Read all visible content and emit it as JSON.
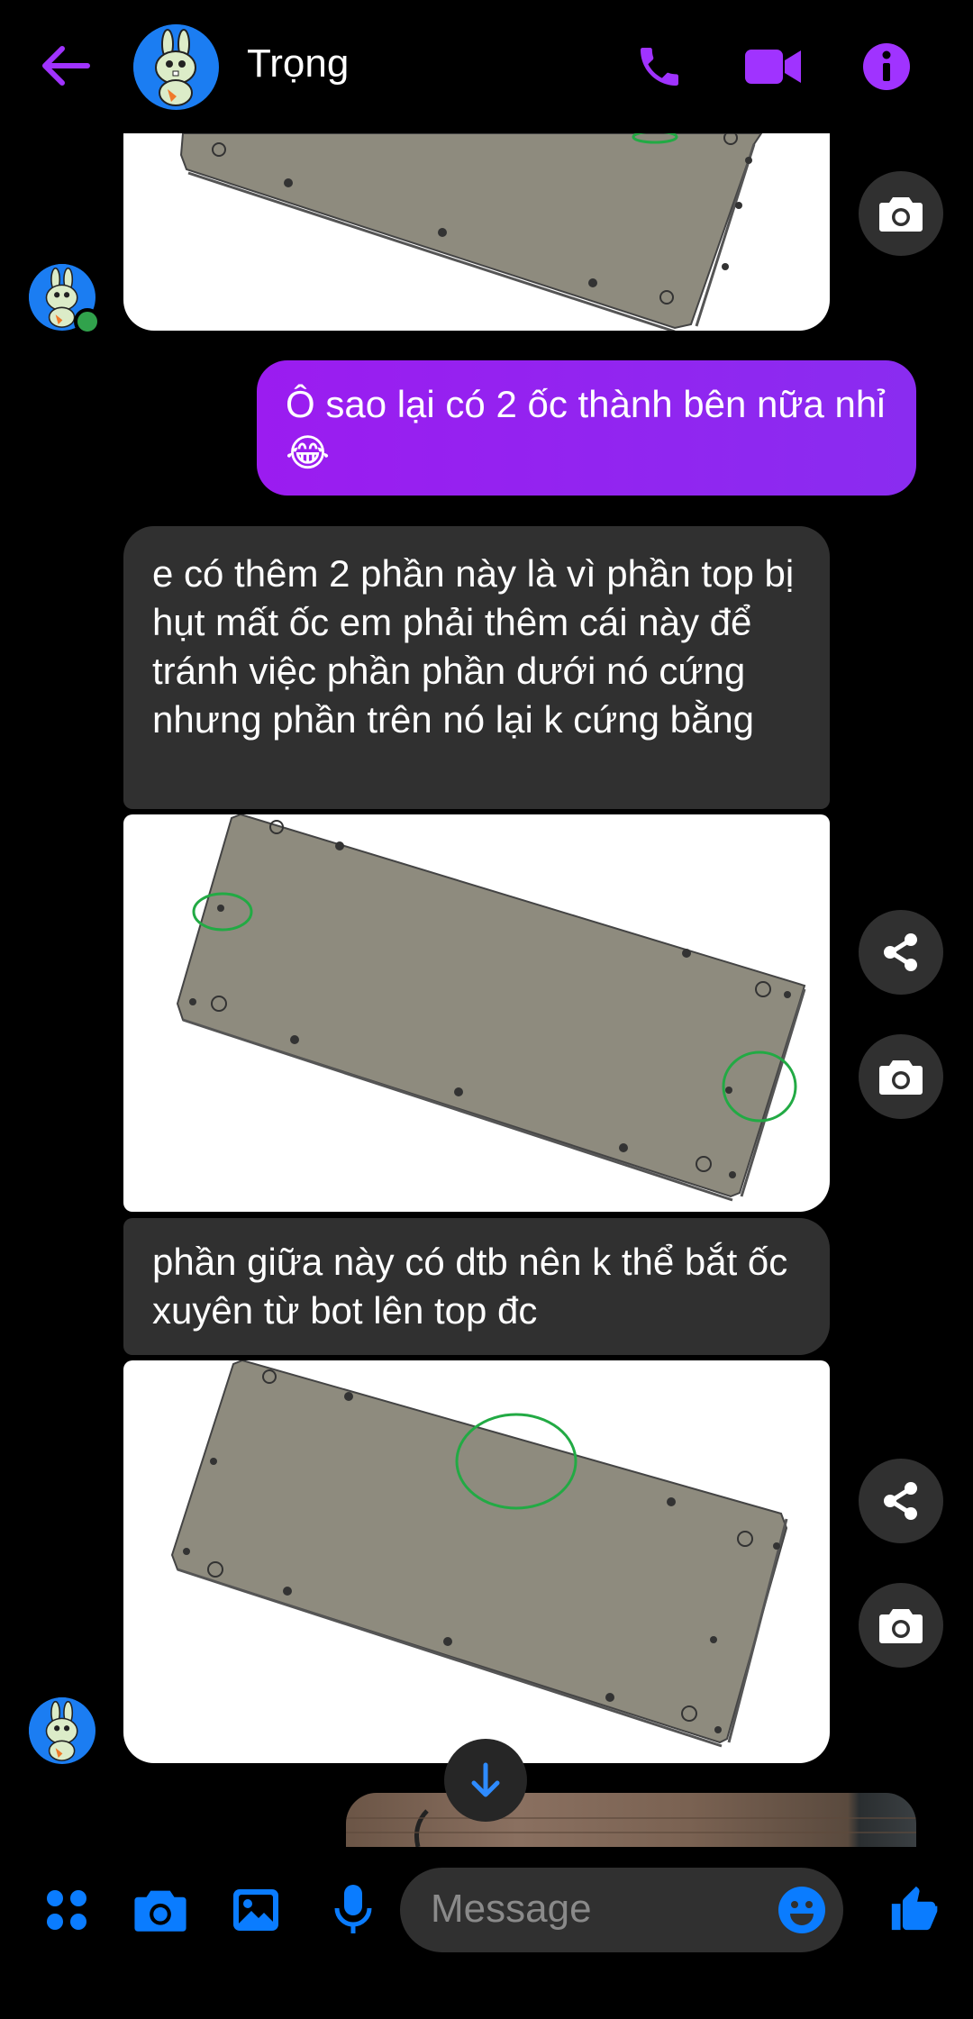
{
  "header": {
    "contact_name": "Trọng",
    "accent_color": "#a033ff"
  },
  "messages": {
    "outgoing_1": "Ô sao lại có 2 ốc thành bên nữa nhỉ",
    "outgoing_1_emoji": "😂",
    "incoming_1": "e có thêm  2 phần này là vì phần top bị hụt mất ốc em phải thêm cái này để tránh việc phần phần dưới nó cứng nhưng phần trên nó lại k cứng bằng",
    "incoming_2": "phần giữa này có dtb nên k thể bắt ốc xuyên từ bot lên top đc"
  },
  "composer": {
    "placeholder": "Message",
    "icon_color": "#0a7cff"
  },
  "icons": [
    "back-arrow-icon",
    "phone-icon",
    "video-icon",
    "info-icon",
    "camera-icon",
    "share-icon",
    "scroll-down-icon",
    "apps-icon",
    "gallery-icon",
    "microphone-icon",
    "emoji-icon",
    "like-icon"
  ]
}
